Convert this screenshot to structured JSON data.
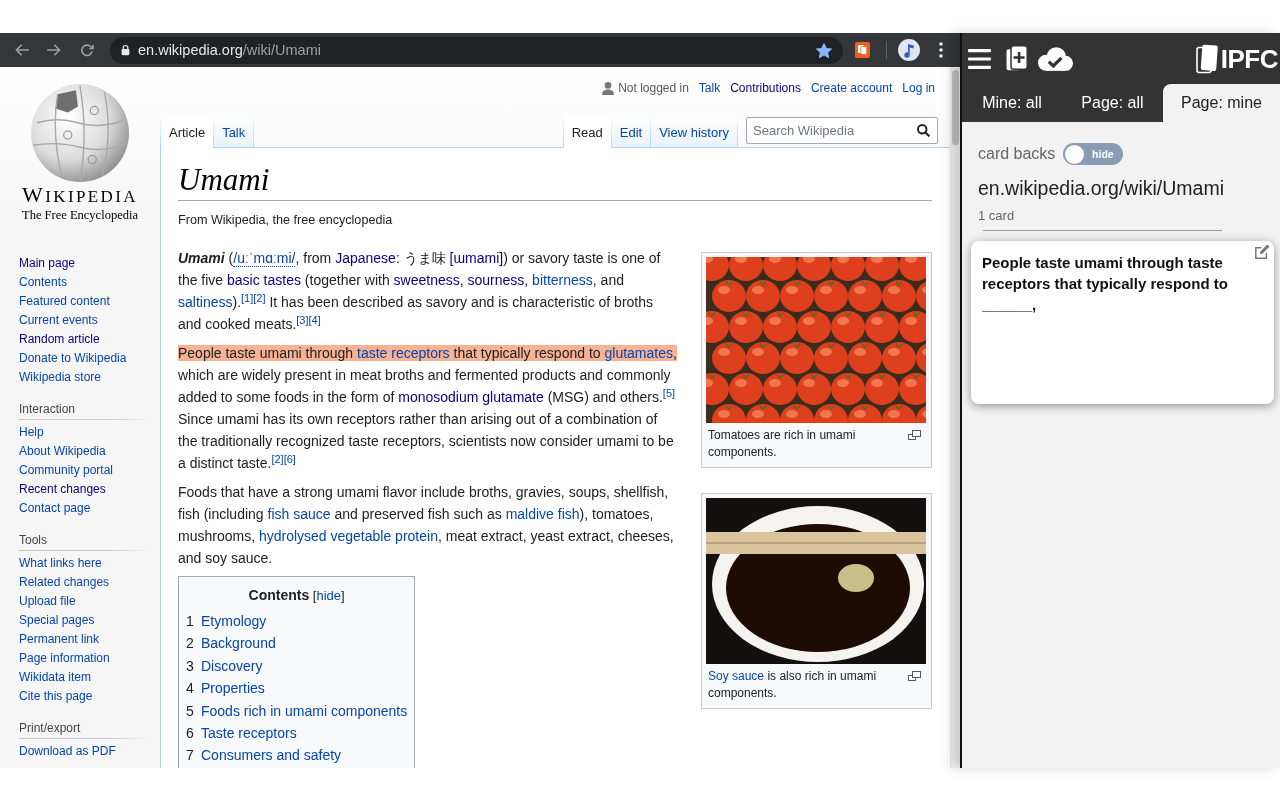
{
  "browser": {
    "url_host": "en.wikipedia.org",
    "url_path": "/wiki/Umami",
    "bookmarked": true
  },
  "wiki": {
    "wordmark": "WIKIPEDIA",
    "tagline": "The Free Encyclopedia",
    "personal_tools": [
      {
        "label": "Not logged in",
        "kind": "status"
      },
      {
        "label": "Talk",
        "kind": "link"
      },
      {
        "label": "Contributions",
        "kind": "visited_link"
      },
      {
        "label": "Create account",
        "kind": "link"
      },
      {
        "label": "Log in",
        "kind": "link"
      }
    ],
    "namespace_tabs": [
      {
        "label": "Article",
        "selected": true
      },
      {
        "label": "Talk",
        "selected": false
      }
    ],
    "view_tabs": [
      {
        "label": "Read",
        "selected": true
      },
      {
        "label": "Edit",
        "selected": false
      },
      {
        "label": "View history",
        "selected": false
      }
    ],
    "search": {
      "placeholder": "Search Wikipedia"
    },
    "sidebar": {
      "navigation": [
        {
          "label": "Main page",
          "visited": true
        },
        {
          "label": "Contents",
          "visited": false
        },
        {
          "label": "Featured content",
          "visited": false
        },
        {
          "label": "Current events",
          "visited": false
        },
        {
          "label": "Random article",
          "visited": true
        },
        {
          "label": "Donate to Wikipedia",
          "visited": false
        },
        {
          "label": "Wikipedia store",
          "visited": false
        }
      ],
      "portlets": [
        {
          "heading": "Interaction",
          "links": [
            {
              "label": "Help",
              "visited": false
            },
            {
              "label": "About Wikipedia",
              "visited": false
            },
            {
              "label": "Community portal",
              "visited": false
            },
            {
              "label": "Recent changes",
              "visited": true
            },
            {
              "label": "Contact page",
              "visited": false
            }
          ]
        },
        {
          "heading": "Tools",
          "links": [
            {
              "label": "What links here",
              "visited": false
            },
            {
              "label": "Related changes",
              "visited": false
            },
            {
              "label": "Upload file",
              "visited": false
            },
            {
              "label": "Special pages",
              "visited": false
            },
            {
              "label": "Permanent link",
              "visited": false
            },
            {
              "label": "Page information",
              "visited": false
            },
            {
              "label": "Wikidata item",
              "visited": false
            },
            {
              "label": "Cite this page",
              "visited": false
            }
          ]
        },
        {
          "heading": "Print/export",
          "links": [
            {
              "label": "Download as PDF",
              "visited": false
            }
          ]
        }
      ]
    },
    "article": {
      "title": "Umami",
      "subtitle": "From Wikipedia, the free encyclopedia",
      "blocks": [
        {
          "kind": "paragraph",
          "segments": [
            {
              "text": "Umami",
              "kind": "term"
            },
            {
              "text": " (",
              "kind": "text"
            },
            {
              "text": "/uːˈmɑːmi/",
              "kind": "ipa"
            },
            {
              "text": ", from ",
              "kind": "text"
            },
            {
              "text": "Japanese",
              "kind": "visited_link"
            },
            {
              "text": ": うま味 ",
              "kind": "text"
            },
            {
              "text": "[ɯmami]",
              "kind": "visited_link"
            },
            {
              "text": ") or savory taste is one of the five ",
              "kind": "text"
            },
            {
              "text": "basic tastes",
              "kind": "visited_link"
            },
            {
              "text": " (together with ",
              "kind": "text"
            },
            {
              "text": "sweetness",
              "kind": "visited_link"
            },
            {
              "text": ", ",
              "kind": "text"
            },
            {
              "text": "sourness",
              "kind": "visited_link"
            },
            {
              "text": ", ",
              "kind": "text"
            },
            {
              "text": "bitterness",
              "kind": "link"
            },
            {
              "text": ", and ",
              "kind": "text"
            },
            {
              "text": "saltiness",
              "kind": "link"
            },
            {
              "text": ").",
              "kind": "text"
            },
            {
              "text": "[1]",
              "kind": "ref"
            },
            {
              "text": "[2]",
              "kind": "ref"
            },
            {
              "text": " It has been described as savory and is characteristic of broths and cooked meats.",
              "kind": "text"
            },
            {
              "text": "[3]",
              "kind": "ref"
            },
            {
              "text": "[4]",
              "kind": "ref"
            }
          ]
        },
        {
          "kind": "paragraph",
          "segments": [
            {
              "kind": "highlight",
              "segments": [
                {
                  "text": "People taste umami through ",
                  "kind": "text"
                },
                {
                  "text": "taste receptors",
                  "kind": "link"
                },
                {
                  "text": " that typically respond to ",
                  "kind": "text"
                },
                {
                  "text": "glutamates",
                  "kind": "link"
                },
                {
                  "text": ",",
                  "kind": "text"
                }
              ]
            },
            {
              "text": " which are widely present in meat broths and fermented products and commonly added to some foods in the form of ",
              "kind": "text"
            },
            {
              "text": "monosodium glutamate",
              "kind": "visited_link"
            },
            {
              "text": " (MSG) and others.",
              "kind": "text"
            },
            {
              "text": "[5]",
              "kind": "ref"
            },
            {
              "text": " Since umami has its own receptors rather than arising out of a combination of the traditionally recognized taste receptors, scientists now consider umami to be a distinct taste.",
              "kind": "text"
            },
            {
              "text": "[2]",
              "kind": "ref"
            },
            {
              "text": "[6]",
              "kind": "ref"
            }
          ]
        },
        {
          "kind": "paragraph",
          "segments": [
            {
              "text": "Foods that have a strong umami flavor include broths, gravies, soups, shellfish, fish (including ",
              "kind": "text"
            },
            {
              "text": "fish sauce",
              "kind": "link"
            },
            {
              "text": " and preserved fish such as ",
              "kind": "text"
            },
            {
              "text": "maldive fish",
              "kind": "link"
            },
            {
              "text": "), tomatoes, mushrooms, ",
              "kind": "text"
            },
            {
              "text": "hydrolysed vegetable protein",
              "kind": "link"
            },
            {
              "text": ", meat extract, yeast extract, cheeses, and soy sauce.",
              "kind": "text"
            }
          ]
        },
        {
          "kind": "toc",
          "heading": [
            {
              "text": "Contents",
              "kind": "heading"
            },
            {
              "text": " [",
              "kind": "text"
            },
            {
              "text": "hide",
              "kind": "link"
            },
            {
              "text": "]",
              "kind": "text"
            }
          ],
          "items": [
            {
              "number": "1",
              "label": "Etymology"
            },
            {
              "number": "2",
              "label": "Background"
            },
            {
              "number": "3",
              "label": "Discovery"
            },
            {
              "number": "4",
              "label": "Properties"
            },
            {
              "number": "5",
              "label": "Foods rich in umami components"
            },
            {
              "number": "6",
              "label": "Taste receptors"
            },
            {
              "number": "7",
              "label": "Consumers and safety"
            }
          ]
        }
      ],
      "figures": [
        {
          "image": {
            "kind": "tomatoes"
          },
          "caption": [
            {
              "text": "Tomatoes are rich in umami components.",
              "kind": "text"
            }
          ]
        },
        {
          "image": {
            "kind": "soy_sauce"
          },
          "caption": [
            {
              "text": "Soy sauce",
              "kind": "link"
            },
            {
              "text": " is also rich in umami components.",
              "kind": "text"
            }
          ]
        }
      ]
    }
  },
  "extension": {
    "logo_text": "IPFC",
    "tabs": [
      {
        "label": "Mine: all",
        "selected": false
      },
      {
        "label": "Page: all",
        "selected": false
      },
      {
        "label": "Page: mine",
        "selected": true
      }
    ],
    "card_backs": {
      "label": "card backs",
      "toggle_label": "hide",
      "on": false
    },
    "page_url": "en.wikipedia.org/wiki/Umami",
    "card_count": "1 card",
    "cards": [
      {
        "front": "People taste umami through taste receptors that typically respond to ______,"
      }
    ]
  }
}
